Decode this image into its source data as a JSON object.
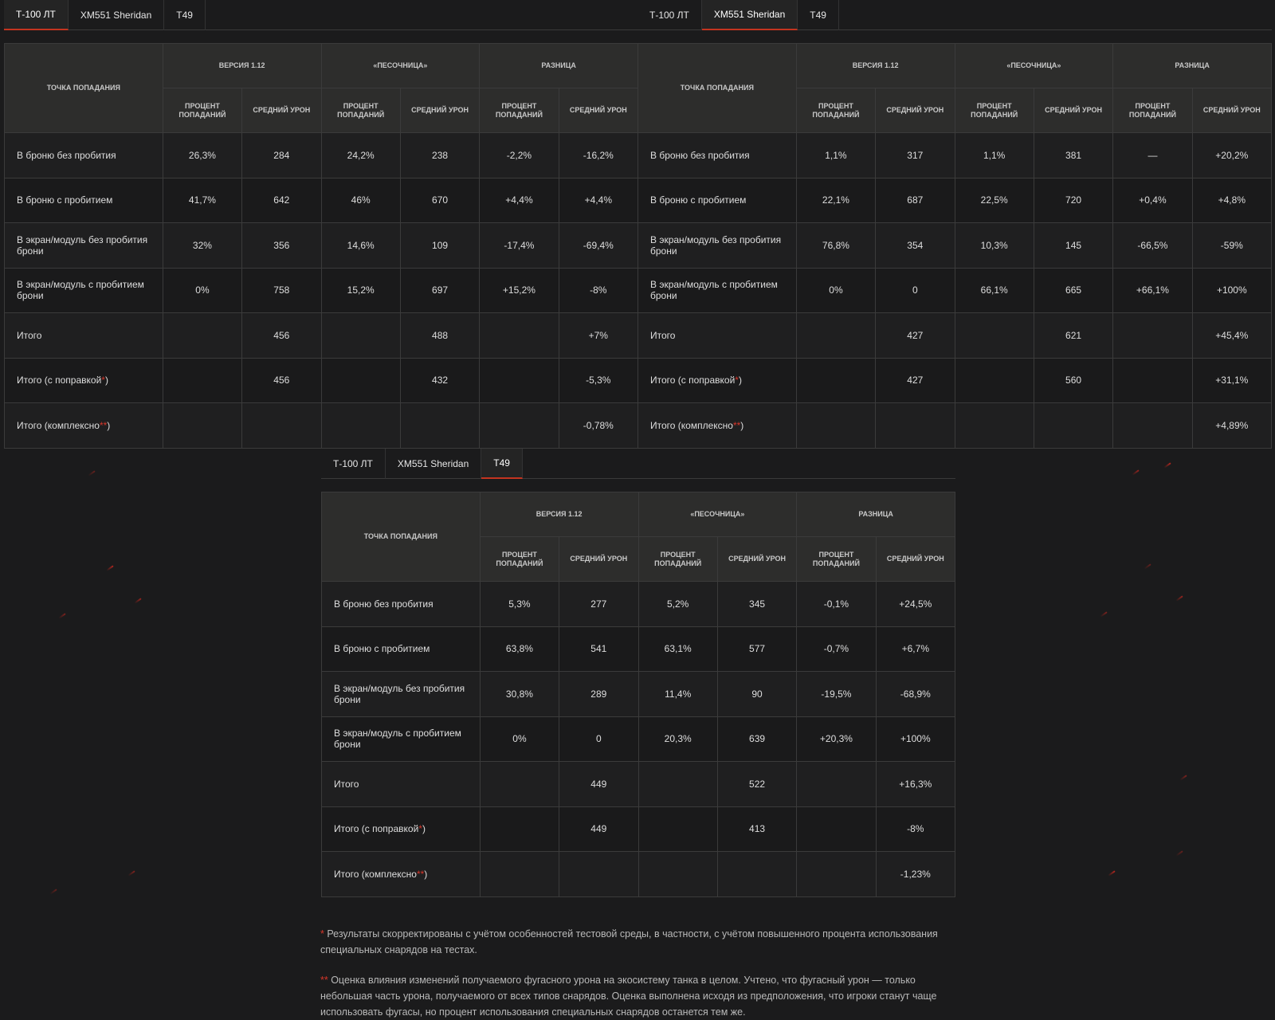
{
  "tabs": [
    "Т-100 ЛТ",
    "XM551 Sheridan",
    "T49"
  ],
  "headers": {
    "hit_point": "Точка попадания",
    "groups": [
      "Версия 1.12",
      "«Песочница»",
      "Разница"
    ],
    "sub": [
      "Процент попаданий",
      "Средний урон"
    ]
  },
  "row_labels": [
    "В броню без пробития",
    "В броню с пробитием",
    "В экран/модуль без пробития брони",
    "В экран/модуль с пробитием брони",
    "Итого",
    "Итого (с поправкой",
    "Итого (комплексно"
  ],
  "row_suffix": {
    "r5": "*",
    "r6": "**",
    "close": ")"
  },
  "tables": {
    "t100": {
      "rows": [
        [
          "26,3%",
          "284",
          "24,2%",
          "238",
          "-2,2%",
          "-16,2%"
        ],
        [
          "41,7%",
          "642",
          "46%",
          "670",
          "+4,4%",
          "+4,4%"
        ],
        [
          "32%",
          "356",
          "14,6%",
          "109",
          "-17,4%",
          "-69,4%"
        ],
        [
          "0%",
          "758",
          "15,2%",
          "697",
          "+15,2%",
          "-8%"
        ],
        [
          "",
          "456",
          "",
          "488",
          "",
          "+7%"
        ],
        [
          "",
          "456",
          "",
          "432",
          "",
          "-5,3%"
        ],
        [
          "",
          "",
          "",
          "",
          "",
          "-0,78%"
        ]
      ]
    },
    "sheridan": {
      "rows": [
        [
          "1,1%",
          "317",
          "1,1%",
          "381",
          "—",
          "+20,2%"
        ],
        [
          "22,1%",
          "687",
          "22,5%",
          "720",
          "+0,4%",
          "+4,8%"
        ],
        [
          "76,8%",
          "354",
          "10,3%",
          "145",
          "-66,5%",
          "-59%"
        ],
        [
          "0%",
          "0",
          "66,1%",
          "665",
          "+66,1%",
          "+100%"
        ],
        [
          "",
          "427",
          "",
          "621",
          "",
          "+45,4%"
        ],
        [
          "",
          "427",
          "",
          "560",
          "",
          "+31,1%"
        ],
        [
          "",
          "",
          "",
          "",
          "",
          "+4,89%"
        ]
      ]
    },
    "t49": {
      "rows": [
        [
          "5,3%",
          "277",
          "5,2%",
          "345",
          "-0,1%",
          "+24,5%"
        ],
        [
          "63,8%",
          "541",
          "63,1%",
          "577",
          "-0,7%",
          "+6,7%"
        ],
        [
          "30,8%",
          "289",
          "11,4%",
          "90",
          "-19,5%",
          "-68,9%"
        ],
        [
          "0%",
          "0",
          "20,3%",
          "639",
          "+20,3%",
          "+100%"
        ],
        [
          "",
          "449",
          "",
          "522",
          "",
          "+16,3%"
        ],
        [
          "",
          "449",
          "",
          "413",
          "",
          "-8%"
        ],
        [
          "",
          "",
          "",
          "",
          "",
          "-1,23%"
        ]
      ]
    }
  },
  "notes": {
    "star1": "*",
    "note1": " Результаты скорректированы с учётом особенностей тестовой среды, в частности, с учётом повышенного процента использования специальных снарядов на тестах.",
    "star2": "**",
    "note2": " Оценка влияния изменений получаемого фугасного урона на экосистему танка в целом. Учтено, что фугасный урон — только небольшая часть урона, получаемого от всех типов снарядов. Оценка выполнена исходя из предположения, что игроки станут чаще использовать фугасы, но процент использования специальных снарядов останется тем же."
  },
  "colors": {
    "accent": "#c4341f",
    "background": "#1b1b1c"
  }
}
